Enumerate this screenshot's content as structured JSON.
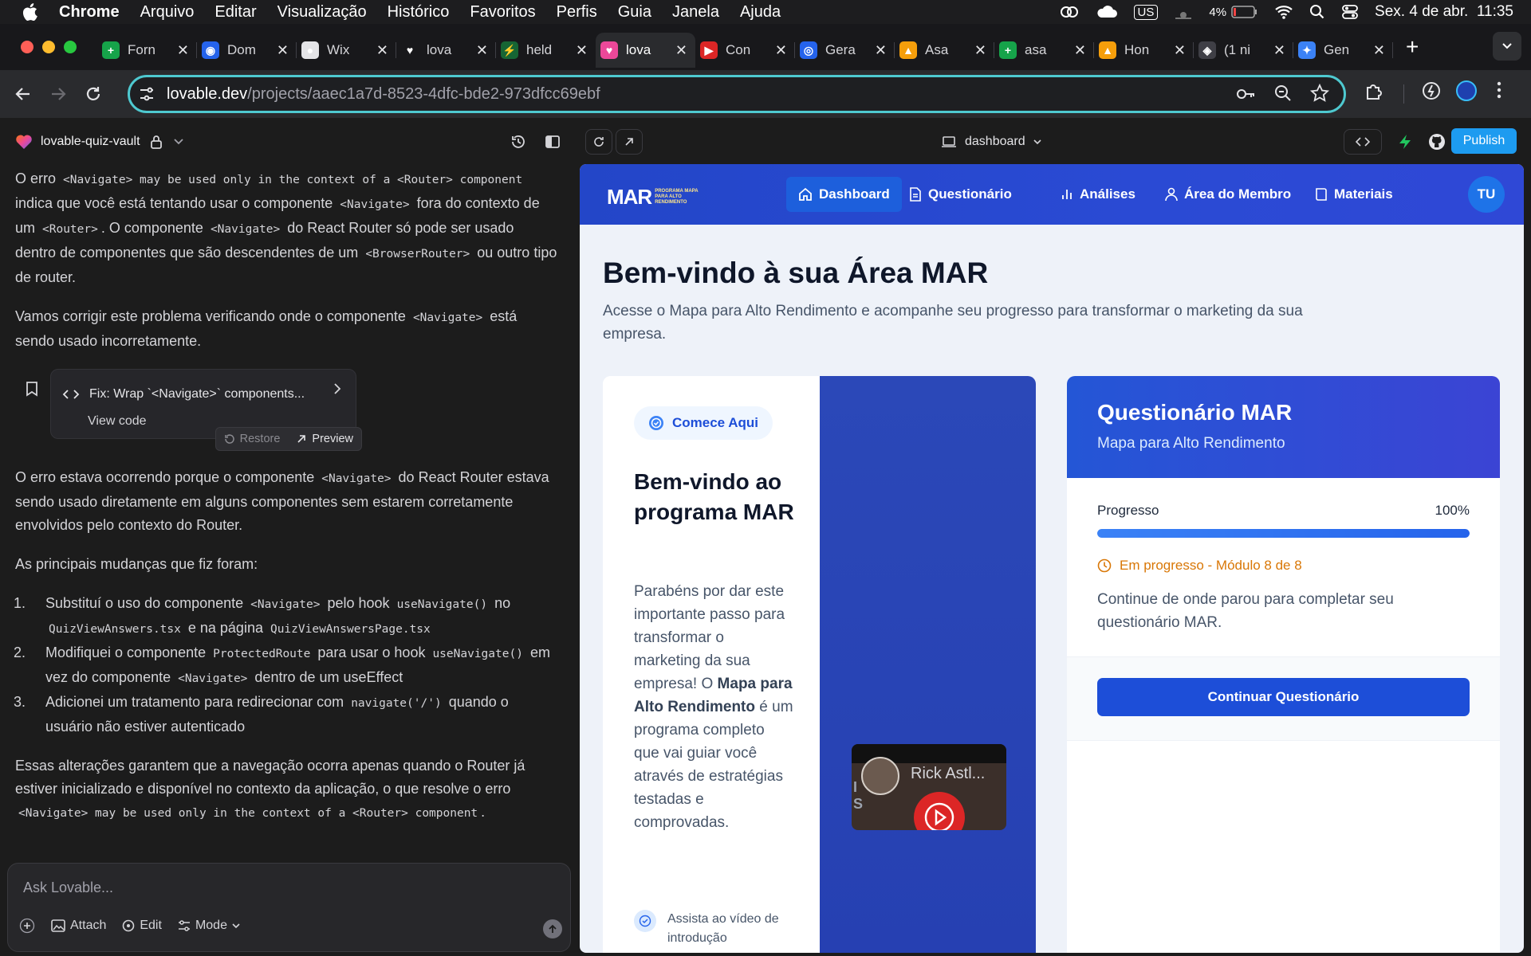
{
  "menubar": {
    "app": "Chrome",
    "items": [
      "Arquivo",
      "Editar",
      "Visualização",
      "Histórico",
      "Favoritos",
      "Perfis",
      "Guia",
      "Janela",
      "Ajuda"
    ],
    "input_source": "US",
    "battery": "4%",
    "datetime": "Sex. 4 de abr.  11:35"
  },
  "tabs": [
    {
      "title": "Forn",
      "color": "#16a34a",
      "glyph": "+"
    },
    {
      "title": "Dom",
      "color": "#2563eb",
      "glyph": "◉"
    },
    {
      "title": "Wix",
      "color": "#e4e4e7",
      "glyph": "●"
    },
    {
      "title": "lova",
      "color": "#18181b",
      "glyph": "♥"
    },
    {
      "title": "held",
      "color": "#166534",
      "glyph": "⚡"
    },
    {
      "title": "lova",
      "color": "#ec4899",
      "glyph": "♥"
    },
    {
      "title": "Con",
      "color": "#dc2626",
      "glyph": "▶"
    },
    {
      "title": "Gera",
      "color": "#2563eb",
      "glyph": "◎"
    },
    {
      "title": "Asa",
      "color": "#f59e0b",
      "glyph": "▲"
    },
    {
      "title": "asa",
      "color": "#16a34a",
      "glyph": "+"
    },
    {
      "title": "Hon",
      "color": "#f59e0b",
      "glyph": "▲"
    },
    {
      "title": "(1 ni",
      "color": "#3f3f46",
      "glyph": "◈"
    },
    {
      "title": "Gen",
      "color": "#3b82f6",
      "glyph": "✦"
    }
  ],
  "tab_active_index": 5,
  "omnibox": {
    "domain": "lovable.dev",
    "path": "/projects/aaec1a7d-8523-4dfc-bde2-973dfcc69ebf"
  },
  "project": {
    "name": "lovable-quiz-vault"
  },
  "chat": {
    "p1": {
      "a": "O erro ",
      "code1": "<Navigate> may be used only in the context of a <Router> component",
      "b": " indica que você está tentando usar o componente ",
      "code2": "<Navigate>",
      "c": " fora do contexto de um ",
      "code3": "<Router>",
      "d": ". O componente ",
      "code4": "<Navigate>",
      "e": " do React Router só pode ser usado dentro de componentes que são descendentes de um ",
      "code5": "<BrowserRouter>",
      "f": " ou outro tipo de router."
    },
    "p2": {
      "a": "Vamos corrigir este problema verificando onde o componente ",
      "code1": "<Navigate>",
      "b": " está sendo usado incorretamente."
    },
    "fix": {
      "title": "Fix: Wrap `<Navigate>` components...",
      "view": "View code",
      "restore": "Restore",
      "preview": "Preview"
    },
    "p3": {
      "a": "O erro estava ocorrendo porque o componente ",
      "code1": "<Navigate>",
      "b": " do React Router estava sendo usado diretamente em alguns componentes sem estarem corretamente envolvidos pelo contexto do Router."
    },
    "p4": "As principais mudanças que fiz foram:",
    "list": {
      "i1": {
        "a": "Substituí o uso do componente ",
        "code1": "<Navigate>",
        "b": " pelo hook ",
        "code2": "useNavigate()",
        "c": " no ",
        "code3": "QuizViewAnswers.tsx",
        "d": " e na página ",
        "code4": "QuizViewAnswersPage.tsx"
      },
      "i2": {
        "a": "Modifiquei o componente ",
        "code1": "ProtectedRoute",
        "b": " para usar o hook ",
        "code2": "useNavigate()",
        "c": " em vez do componente ",
        "code3": "<Navigate>",
        "d": " dentro de um useEffect"
      },
      "i3": {
        "a": "Adicionei um tratamento para redirecionar com ",
        "code1": "navigate('/')",
        "b": " quando o usuário não estiver autenticado"
      }
    },
    "p5": {
      "a": "Essas alterações garantem que a navegação ocorra apenas quando o Router já estiver inicializado e disponível no contexto da aplicação, o que resolve o erro ",
      "code1": "<Navigate> may be used only in the context of a <Router> component",
      "b": "."
    }
  },
  "ask": {
    "placeholder": "Ask Lovable...",
    "attach": "Attach",
    "edit": "Edit",
    "mode": "Mode"
  },
  "preview_toolbar": {
    "route": "dashboard",
    "publish": "Publish"
  },
  "app": {
    "logo": "MAR",
    "logo_sub": "PROGRAMA MAPA PARA ALTO RENDIMENTO",
    "nav": [
      "Dashboard",
      "Questionário",
      "Análises",
      "Área do Membro",
      "Materiais"
    ],
    "avatar": "TU",
    "title": "Bem-vindo à sua Área MAR",
    "subtitle": "Acesse o Mapa para Alto Rendimento e acompanhe seu progresso para transformar o marketing da sua empresa.",
    "intro": {
      "chip": "Comece Aqui",
      "heading": "Bem-vindo ao programa MAR",
      "body_a": "Parabéns por dar este importante passo para transformar o marketing da sua empresa! O ",
      "body_b": "Mapa para Alto Rendimento",
      "body_c": " é um programa completo que vai guiar você através de estratégias testadas e comprovadas.",
      "step1": "Assista ao vídeo de introdução",
      "video_title": "Rick Astl..."
    },
    "quiz": {
      "title": "Questionário MAR",
      "subtitle": "Mapa para Alto Rendimento",
      "progress_label": "Progresso",
      "progress_value": "100%",
      "progress_fraction": 1.0,
      "status": "Em progresso - Módulo 8 de 8",
      "continue_text": "Continue de onde parou para completar seu questionário MAR.",
      "button": "Continuar Questionário"
    }
  },
  "colors": {
    "accent": "#1d4ed8",
    "publish": "#1d9bf0",
    "omnibox_border": "#4ec9d0",
    "warning": "#d97706"
  }
}
